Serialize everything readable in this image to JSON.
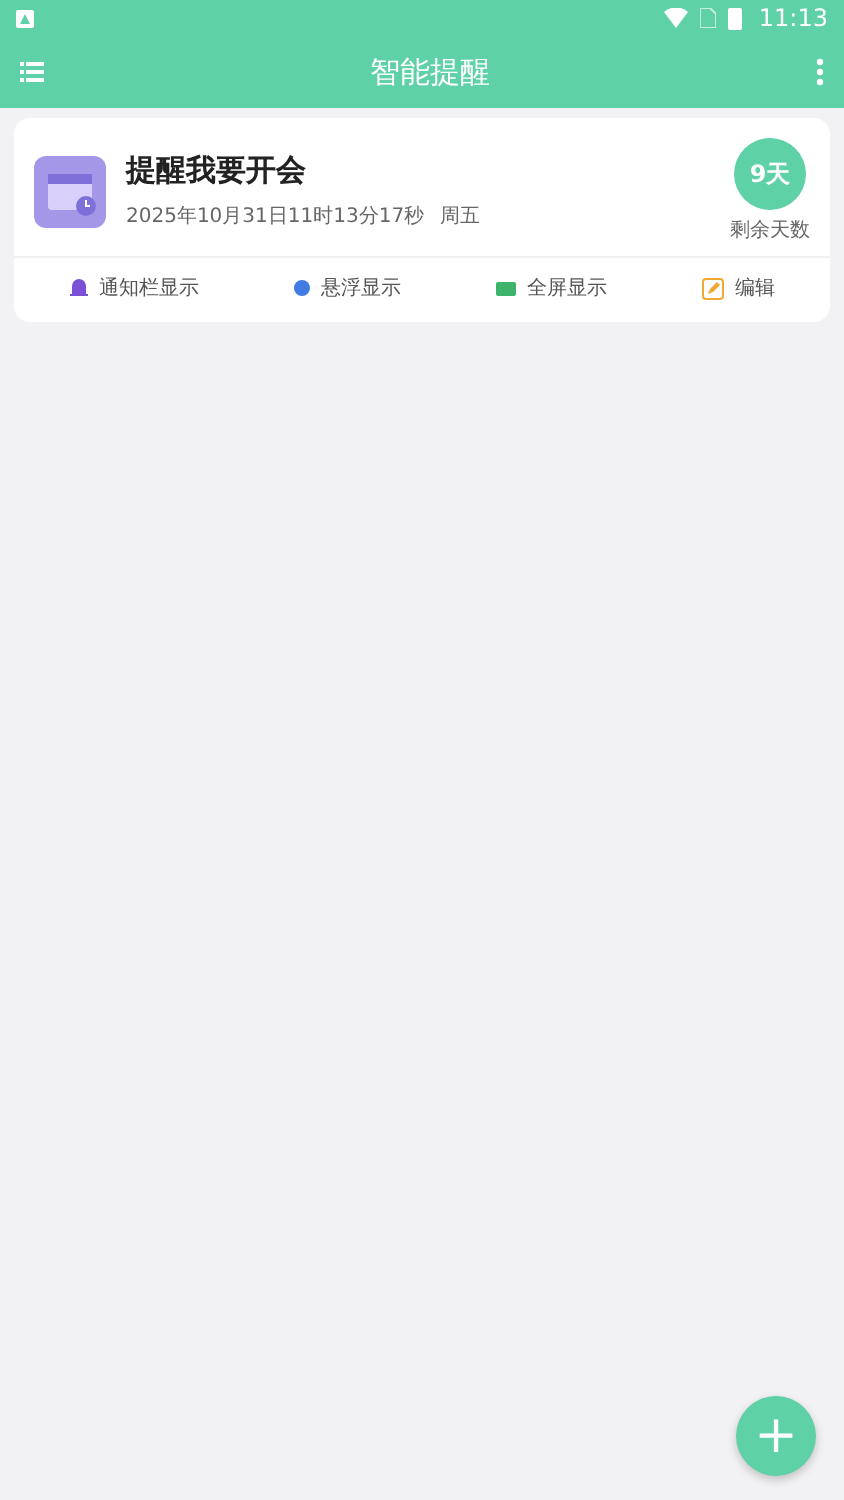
{
  "status_bar": {
    "time": "11:13"
  },
  "app_bar": {
    "title": "智能提醒"
  },
  "reminders": [
    {
      "title": "提醒我要开会",
      "datetime": "2025年10月31日11时13分17秒",
      "weekday": "周五",
      "days": "9天",
      "days_label": "剩余天数",
      "actions": [
        {
          "kind": "bell",
          "label": "通知栏显示",
          "color": "#7b4fd6"
        },
        {
          "kind": "dot",
          "label": "悬浮显示",
          "color": "#3f7be0"
        },
        {
          "kind": "screen",
          "label": "全屏显示",
          "color": "#3db36b"
        },
        {
          "kind": "edit",
          "label": "编辑",
          "color": "#f0a830"
        }
      ]
    }
  ],
  "fab": {
    "label": "+"
  }
}
